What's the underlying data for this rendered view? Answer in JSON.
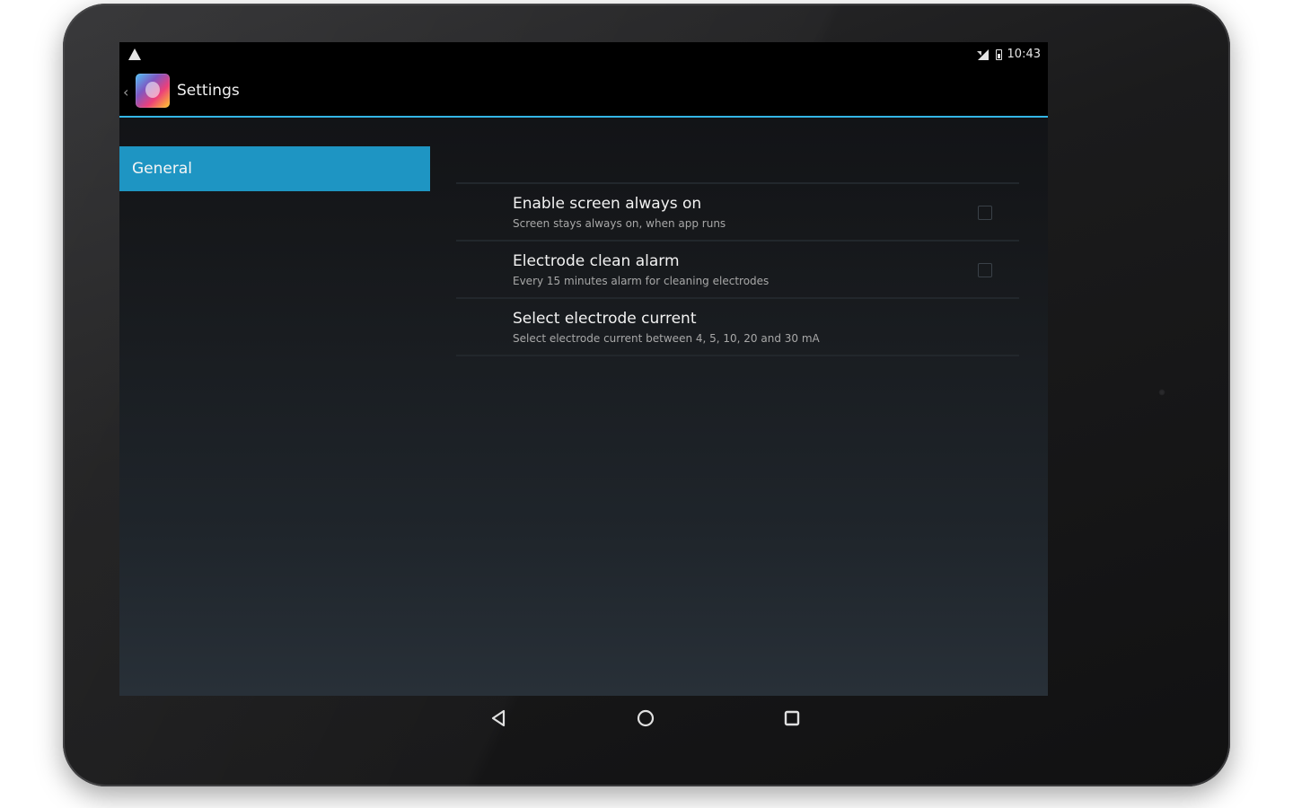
{
  "status_bar": {
    "time": "10:43",
    "icons": [
      "warning-icon",
      "signal-icon",
      "battery-icon"
    ]
  },
  "action_bar": {
    "title": "Settings",
    "accent_color": "#33b5e5"
  },
  "headers": [
    {
      "label": "General",
      "selected": true
    }
  ],
  "preferences": [
    {
      "title": "Enable screen always on",
      "summary": "Screen stays always on, when app runs",
      "has_checkbox": true,
      "checked": false
    },
    {
      "title": "Electrode clean alarm",
      "summary": "Every 15 minutes alarm for cleaning electrodes",
      "has_checkbox": true,
      "checked": false
    },
    {
      "title": "Select electrode current",
      "summary": "Select electrode current between 4, 5, 10, 20 and 30 mA",
      "has_checkbox": false
    }
  ],
  "nav_bar": {
    "buttons": [
      "back-icon",
      "home-icon",
      "recents-icon"
    ]
  },
  "colors": {
    "selected_header": "#1e95c3",
    "screen_bg_top": "#101114",
    "screen_bg_bottom": "#283038"
  }
}
